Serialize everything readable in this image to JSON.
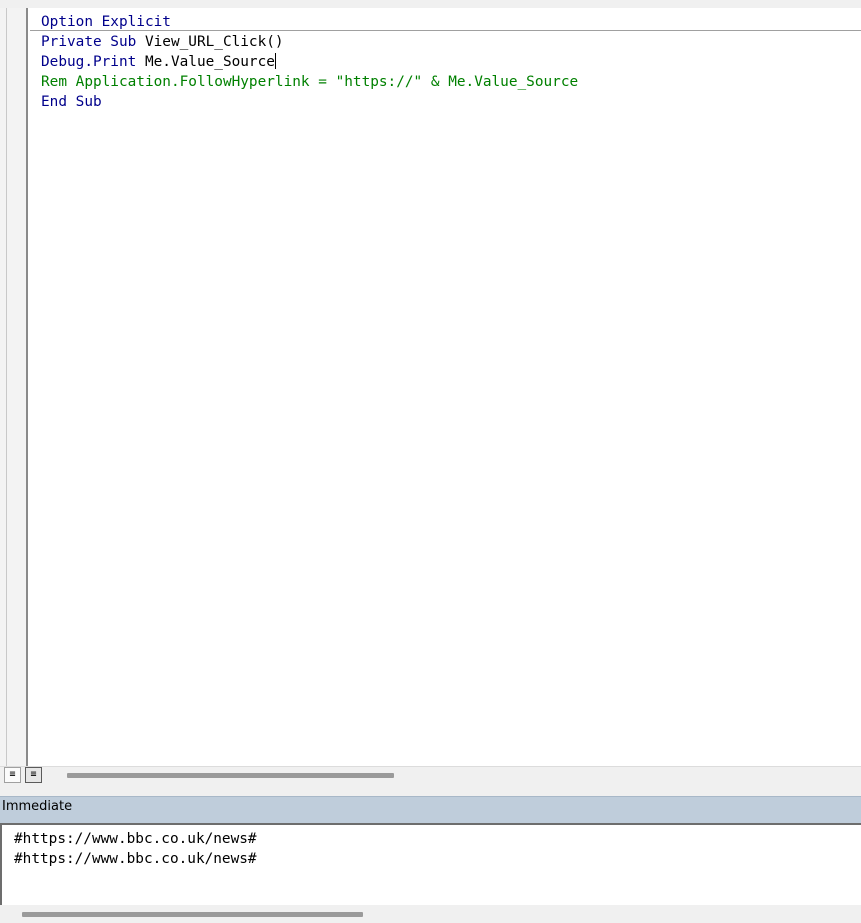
{
  "code_window": {
    "lines": [
      [
        {
          "t": "Option Explicit",
          "c": "kw"
        }
      ],
      [
        {
          "t": "Private Sub ",
          "c": "kw"
        },
        {
          "t": "View_URL_Click()",
          "c": "id"
        }
      ],
      [
        {
          "t": "Debug.Print ",
          "c": "kw"
        },
        {
          "t": "Me.Value_Source",
          "c": "id"
        }
      ],
      [
        {
          "t": "Rem Application.FollowHyperlink = \"https://\" & Me.Value_Source",
          "c": "cm"
        }
      ],
      [
        {
          "t": "End Sub",
          "c": "kw"
        }
      ]
    ]
  },
  "immediate": {
    "title": "Immediate",
    "lines": [
      "#https://www.bbc.co.uk/news#",
      "#https://www.bbc.co.uk/news#"
    ]
  },
  "icons": {
    "procedure_view": "procedure-view-icon",
    "full_module_view": "full-module-view-icon"
  },
  "colors": {
    "keyword": "#00008b",
    "comment": "#008000",
    "identifier": "#000000",
    "immediate_title_bg": "#bfcddb"
  }
}
